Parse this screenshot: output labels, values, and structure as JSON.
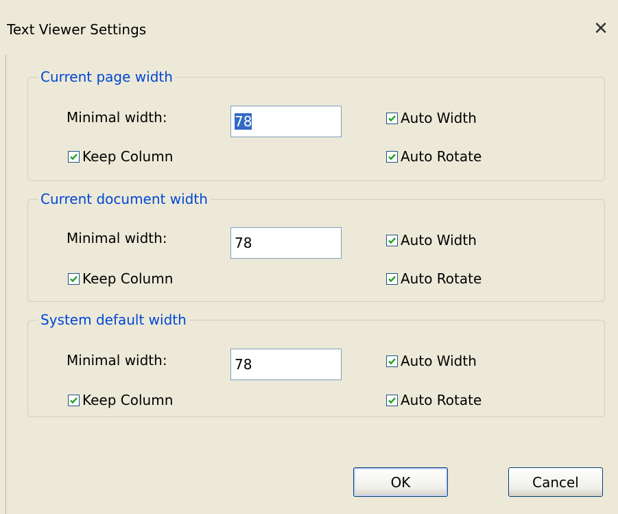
{
  "window": {
    "title": "Text Viewer Settings",
    "close_glyph": "✕"
  },
  "groups": [
    {
      "title": "Current page width",
      "minimal_width_label": "Minimal width:",
      "minimal_width_value": "78",
      "keep_column_label": "Keep Column",
      "keep_column_checked": true,
      "auto_width_label": "Auto Width",
      "auto_width_checked": true,
      "auto_rotate_label": "Auto Rotate",
      "auto_rotate_checked": true
    },
    {
      "title": "Current document width",
      "minimal_width_label": "Minimal width:",
      "minimal_width_value": "78",
      "keep_column_label": "Keep Column",
      "keep_column_checked": true,
      "auto_width_label": "Auto Width",
      "auto_width_checked": true,
      "auto_rotate_label": "Auto Rotate",
      "auto_rotate_checked": true
    },
    {
      "title": "System default width",
      "minimal_width_label": "Minimal width:",
      "minimal_width_value": "78",
      "keep_column_label": "Keep Column",
      "keep_column_checked": true,
      "auto_width_label": "Auto Width",
      "auto_width_checked": true,
      "auto_rotate_label": "Auto Rotate",
      "auto_rotate_checked": true
    }
  ],
  "buttons": {
    "ok_label": "OK",
    "cancel_label": "Cancel"
  },
  "colors": {
    "group_title": "#0046d5",
    "background": "#ece9d8",
    "check": "#21a121",
    "selection": "#316ac5"
  },
  "icons": {
    "check": "checkmark-icon",
    "close": "close-icon"
  }
}
